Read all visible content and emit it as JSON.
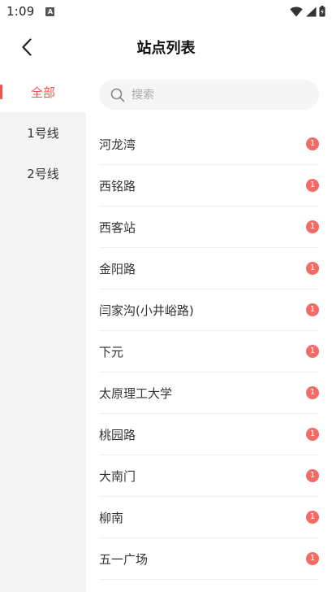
{
  "status": {
    "time": "1:09",
    "notification_glyph": "A"
  },
  "header": {
    "title": "站点列表"
  },
  "sidebar": {
    "items": [
      {
        "label": "全部"
      },
      {
        "label": "1号线"
      },
      {
        "label": "2号线"
      }
    ]
  },
  "search": {
    "value": "",
    "placeholder": "搜索"
  },
  "stations": [
    {
      "name": "河龙湾",
      "count": "1"
    },
    {
      "name": "西铭路",
      "count": "1"
    },
    {
      "name": "西客站",
      "count": "1"
    },
    {
      "name": "金阳路",
      "count": "1"
    },
    {
      "name": "闫家沟(小井峪路)",
      "count": "1"
    },
    {
      "name": "下元",
      "count": "1"
    },
    {
      "name": "太原理工大学",
      "count": "1"
    },
    {
      "name": "桃园路",
      "count": "1"
    },
    {
      "name": "大南门",
      "count": "1"
    },
    {
      "name": "柳南",
      "count": "1"
    },
    {
      "name": "五一广场",
      "count": "1"
    }
  ],
  "colors": {
    "accent": "#f0544f",
    "badge": "#f36b66"
  },
  "icons": {
    "back": "chevron-left-icon",
    "search": "search-icon",
    "wifi": "wifi-icon",
    "signal": "signal-icon",
    "battery": "battery-icon"
  }
}
